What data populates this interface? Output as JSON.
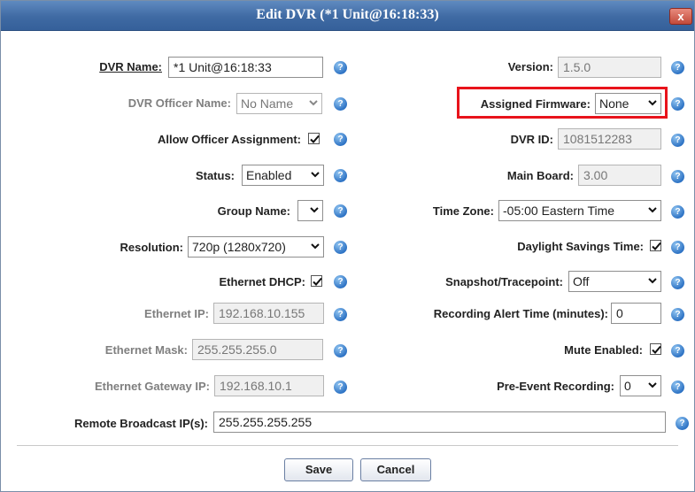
{
  "dialog": {
    "title": "Edit DVR (*1 Unit@16:18:33)",
    "close_label": "x"
  },
  "left": {
    "dvr_name": {
      "label": "DVR Name:",
      "value": "*1 Unit@16:18:33"
    },
    "officer_name": {
      "label": "DVR Officer Name:",
      "value": "No Name"
    },
    "allow_officer": {
      "label": "Allow Officer Assignment:",
      "checked": true
    },
    "status": {
      "label": "Status:",
      "value": "Enabled"
    },
    "group_name": {
      "label": "Group Name:",
      "value": ""
    },
    "resolution": {
      "label": "Resolution:",
      "value": "720p (1280x720)"
    },
    "ethernet_dhcp": {
      "label": "Ethernet DHCP:",
      "checked": true
    },
    "ethernet_ip": {
      "label": "Ethernet IP:",
      "value": "192.168.10.155"
    },
    "ethernet_mask": {
      "label": "Ethernet Mask:",
      "value": "255.255.255.0"
    },
    "ethernet_gateway": {
      "label": "Ethernet Gateway IP:",
      "value": "192.168.10.1"
    }
  },
  "right": {
    "version": {
      "label": "Version:",
      "value": "1.5.0"
    },
    "firmware": {
      "label": "Assigned Firmware:",
      "value": "None"
    },
    "dvr_id": {
      "label": "DVR ID:",
      "value": "1081512283"
    },
    "main_board": {
      "label": "Main Board:",
      "value": "3.00"
    },
    "time_zone": {
      "label": "Time Zone:",
      "value": "-05:00 Eastern Time"
    },
    "dst": {
      "label": "Daylight Savings Time:",
      "checked": true
    },
    "snapshot": {
      "label": "Snapshot/Tracepoint:",
      "value": "Off"
    },
    "alert_time": {
      "label": "Recording Alert Time (minutes):",
      "value": "0"
    },
    "mute": {
      "label": "Mute Enabled:",
      "checked": true
    },
    "pre_event": {
      "label": "Pre-Event Recording:",
      "value": "0"
    }
  },
  "broadcast": {
    "label": "Remote Broadcast IP(s):",
    "value": "255.255.255.255"
  },
  "buttons": {
    "save": "Save",
    "cancel": "Cancel"
  },
  "help_glyph": "?",
  "colors": {
    "titlebar": "#3f6aa3",
    "highlight": "#e8131b",
    "help_icon": "#2f74c5"
  }
}
